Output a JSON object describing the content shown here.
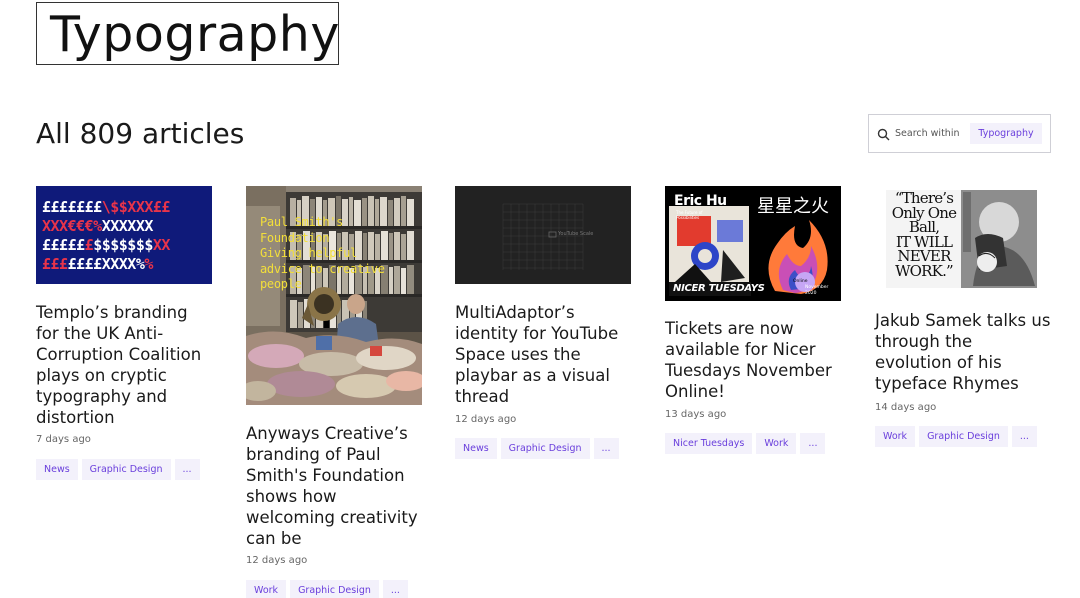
{
  "page": {
    "title": "Typography",
    "article_count": "All 809 articles"
  },
  "search": {
    "label": "Search within",
    "chip": "Typography"
  },
  "cards": [
    {
      "thumb_lines": [
        "£££££££\\$$XXX££",
        "XXX€€€%XXXXXX",
        "£££££$$$$$$$XX",
        "£££££££XXXX%%"
      ],
      "title": "Templo’s branding for the UK Anti-Corruption Coalition plays on cryptic typography and distortion",
      "date": "7 days ago",
      "tags": [
        "News",
        "Graphic Design",
        "..."
      ]
    },
    {
      "thumb_text": [
        "Paul Smith's",
        "Foundation",
        "Giving helpful",
        "advice to creative",
        "people"
      ],
      "title": "Anyways Creative’s branding of Paul Smith's Foundation shows how welcoming creativity can be",
      "date": "12 days ago",
      "tags": [
        "Work",
        "Graphic Design",
        "..."
      ]
    },
    {
      "thumb_label": "YouTube Scale",
      "title": "MultiAdaptor’s identity for YouTube Space uses the playbar as a visual thread",
      "date": "12 days ago",
      "tags": [
        "News",
        "Graphic Design",
        "..."
      ]
    },
    {
      "thumb_text": {
        "name": "Eric Hu",
        "sub": "The Future of Possibilities",
        "cjk": "星星之火",
        "banner": "NICER TUESDAYS",
        "badge_line1": "Online",
        "badge_line2": "November 2020"
      },
      "title": "Tickets are now available for Nicer Tuesdays November Online!",
      "date": "13 days ago",
      "tags": [
        "Nicer Tuesdays",
        "Work",
        "..."
      ]
    },
    {
      "thumb_text": [
        "“There’s",
        "Only One",
        "Ball,",
        "IT WILL",
        "NEVER",
        "WORK.”"
      ],
      "title": "Jakub Samek talks us through the evolution of his typeface Rhymes",
      "date": "14 days ago",
      "tags": [
        "Work",
        "Graphic Design",
        "..."
      ]
    }
  ],
  "colors": {
    "accent": "#6a3fdc",
    "chip_bg": "#f3f1fb",
    "thumb1_bg": "#0f1a7a",
    "thumb1_red": "#e8344a"
  }
}
